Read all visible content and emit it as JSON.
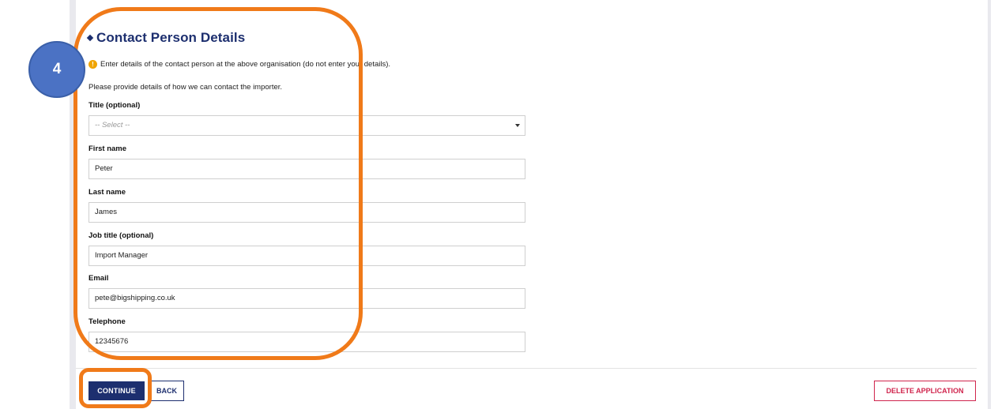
{
  "section": {
    "heading": "Contact Person Details",
    "warning": "Enter details of the contact person at the above organisation (do not enter your details).",
    "hint": "Please provide details of how we can contact the importer."
  },
  "form": {
    "title": {
      "label": "Title (optional)",
      "value": "-- Select --"
    },
    "first_name": {
      "label": "First name",
      "value": "Peter"
    },
    "last_name": {
      "label": "Last name",
      "value": "James"
    },
    "job_title": {
      "label": "Job title (optional)",
      "value": "Import Manager"
    },
    "email": {
      "label": "Email",
      "value": "pete@bigshipping.co.uk"
    },
    "telephone": {
      "label": "Telephone",
      "value": "12345676"
    }
  },
  "actions": {
    "continue_label": "CONTINUE",
    "back_label": "BACK",
    "delete_label": "DELETE APPLICATION"
  },
  "annotation": {
    "step_number": "4",
    "highlight_color": "#f07a19",
    "badge_color": "#4b72c4"
  },
  "colors": {
    "primary": "#1d2f6f",
    "danger": "#d0254d",
    "warning": "#f0a400"
  }
}
